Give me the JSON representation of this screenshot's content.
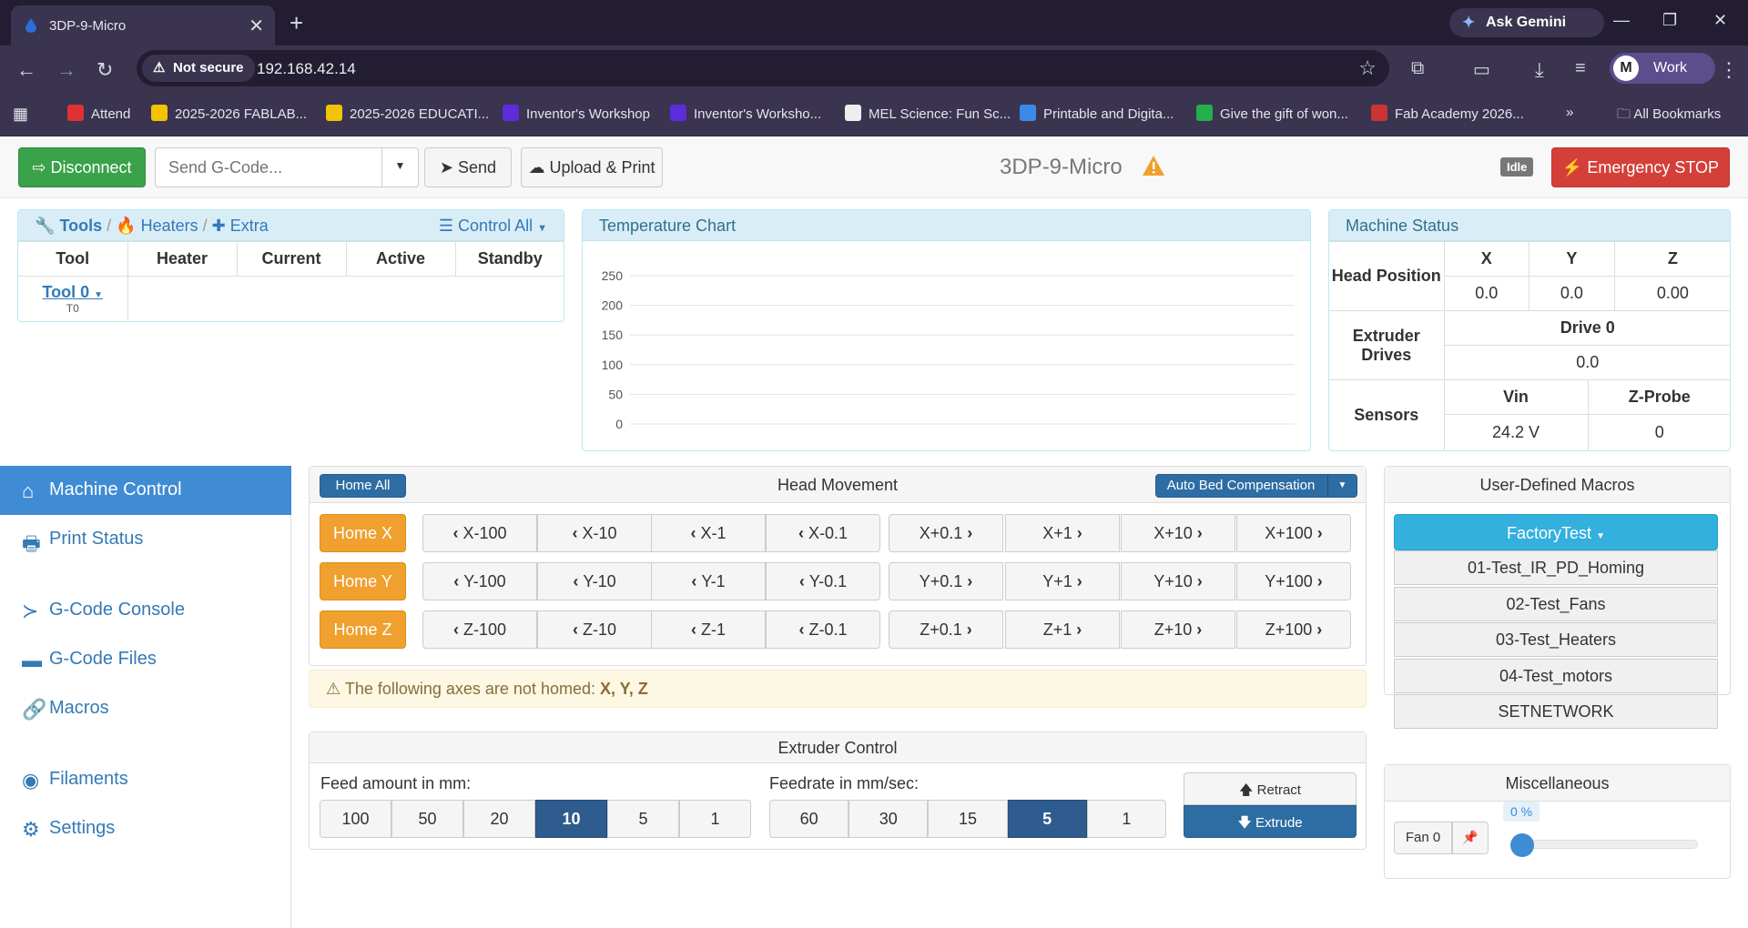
{
  "browser": {
    "tab_title": "3DP-9-Micro",
    "gemini_label": "Ask Gemini",
    "not_secure_label": "Not secure",
    "url": "192.168.42.14",
    "profile_label": "Work",
    "profile_initial": "M",
    "bookmarks": [
      {
        "label": "Attend",
        "color": "#d33"
      },
      {
        "label": "2025-2026 FABLAB...",
        "color": "#f2c400"
      },
      {
        "label": "2025-2026 EDUCATI...",
        "color": "#f2c400"
      },
      {
        "label": "Inventor's Workshop",
        "color": "#5b2ddb"
      },
      {
        "label": "Inventor's Worksho...",
        "color": "#5b2ddb"
      },
      {
        "label": "MEL Science: Fun Sc...",
        "color": "#eee"
      },
      {
        "label": "Printable and Digita...",
        "color": "#3a8ae8"
      },
      {
        "label": "Give the gift of won...",
        "color": "#23b04a"
      },
      {
        "label": "Fab Academy 2026...",
        "color": "#c33"
      }
    ],
    "all_bookmarks_label": "All Bookmarks"
  },
  "toolbar": {
    "disconnect_label": "Disconnect",
    "gcode_placeholder": "Send G-Code...",
    "send_label": "Send",
    "upload_label": "Upload & Print",
    "machine_name": "3DP-9-Micro",
    "status_badge": "Idle",
    "emergency_label": "Emergency STOP"
  },
  "tools_panel": {
    "crumb_tools": "Tools",
    "crumb_heaters": "Heaters",
    "crumb_extra": "Extra",
    "control_all": "Control All",
    "columns": [
      "Tool",
      "Heater",
      "Current",
      "Active",
      "Standby"
    ],
    "tool_name": "Tool 0",
    "tool_sub": "T0"
  },
  "temp_chart": {
    "title": "Temperature Chart",
    "chart_data": {
      "type": "line",
      "title": "Temperature Chart",
      "ylim": [
        0,
        250
      ],
      "yticks": [
        0,
        50,
        100,
        150,
        200,
        250
      ],
      "grid": true,
      "series": []
    }
  },
  "machine_status": {
    "title": "Machine Status",
    "head_position_label": "Head Position",
    "axes": [
      "X",
      "Y",
      "Z"
    ],
    "positions": [
      "0.0",
      "0.0",
      "0.00"
    ],
    "extruder_label": "Extruder Drives",
    "drive_label": "Drive 0",
    "drive_value": "0.0",
    "sensors_label": "Sensors",
    "sensor_names": [
      "Vin",
      "Z-Probe"
    ],
    "sensor_values": [
      "24.2 V",
      "0"
    ]
  },
  "sidebar": {
    "items": [
      {
        "label": "Machine Control",
        "icon": "home-icon"
      },
      {
        "label": "Print Status",
        "icon": "printer-icon"
      },
      {
        "label": "G-Code Console",
        "icon": "terminal-icon"
      },
      {
        "label": "G-Code Files",
        "icon": "hdd-icon"
      },
      {
        "label": "Macros",
        "icon": "link-icon"
      },
      {
        "label": "Filaments",
        "icon": "globe-icon"
      },
      {
        "label": "Settings",
        "icon": "cog-icon"
      }
    ]
  },
  "head_movement": {
    "home_all": "Home All",
    "title": "Head Movement",
    "auto_bed": "Auto Bed Compensation",
    "rows": [
      {
        "home": "Home X",
        "neg": [
          "X-100",
          "X-10",
          "X-1",
          "X-0.1"
        ],
        "pos": [
          "X+0.1",
          "X+1",
          "X+10",
          "X+100"
        ]
      },
      {
        "home": "Home Y",
        "neg": [
          "Y-100",
          "Y-10",
          "Y-1",
          "Y-0.1"
        ],
        "pos": [
          "Y+0.1",
          "Y+1",
          "Y+10",
          "Y+100"
        ]
      },
      {
        "home": "Home Z",
        "neg": [
          "Z-100",
          "Z-10",
          "Z-1",
          "Z-0.1"
        ],
        "pos": [
          "Z+0.1",
          "Z+1",
          "Z+10",
          "Z+100"
        ]
      }
    ],
    "warning_text": "The following axes are not homed: ",
    "warning_axes": "X, Y, Z"
  },
  "extruder": {
    "title": "Extruder Control",
    "feed_label": "Feed amount in mm:",
    "feed_options": [
      "100",
      "50",
      "20",
      "10",
      "5",
      "1"
    ],
    "feed_selected": "10",
    "rate_label": "Feedrate in mm/sec:",
    "rate_options": [
      "60",
      "30",
      "15",
      "5",
      "1"
    ],
    "rate_selected": "5",
    "retract_label": "Retract",
    "extrude_label": "Extrude"
  },
  "macros": {
    "title": "User-Defined Macros",
    "folder": "FactoryTest",
    "items": [
      "01-Test_IR_PD_Homing",
      "02-Test_Fans",
      "03-Test_Heaters",
      "04-Test_motors",
      "SETNETWORK"
    ]
  },
  "misc": {
    "title": "Miscellaneous",
    "fan_label": "Fan 0",
    "fan_value": "0 %",
    "fan_level": 0
  }
}
